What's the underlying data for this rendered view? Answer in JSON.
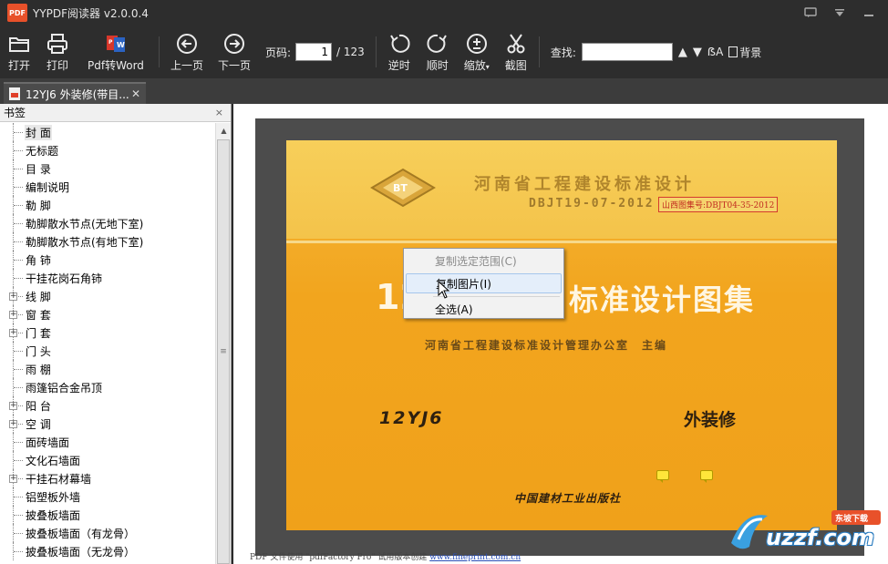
{
  "window": {
    "logo_text": "PDF",
    "title": "YYPDF阅读器 v2.0.0.4"
  },
  "toolbar": {
    "open": "打开",
    "print": "打印",
    "pdf_to_word": "Pdf转Word",
    "prev_page": "上一页",
    "next_page": "下一页",
    "page_label": "页码:",
    "page_current": "1",
    "page_total": "/ 123",
    "rotate_ccw": "逆时",
    "rotate_cw": "顺时",
    "zoom": "缩放",
    "screenshot": "截图",
    "find_label": "查找:",
    "find_value": "",
    "background": "背景"
  },
  "tab": {
    "label": "12YJ6 外装修(带目...",
    "close": "✕"
  },
  "sidebar": {
    "title": "书签",
    "close": "×",
    "items": [
      {
        "label": "封 面",
        "expandable": false,
        "selected": true
      },
      {
        "label": "无标题",
        "expandable": false
      },
      {
        "label": "目 录",
        "expandable": false
      },
      {
        "label": "编制说明",
        "expandable": false
      },
      {
        "label": "勒 脚",
        "expandable": false
      },
      {
        "label": "勒脚散水节点(无地下室)",
        "expandable": false
      },
      {
        "label": "勒脚散水节点(有地下室)",
        "expandable": false
      },
      {
        "label": "角 铈",
        "expandable": false
      },
      {
        "label": "干挂花岗石角铈",
        "expandable": false
      },
      {
        "label": "线 脚",
        "expandable": true
      },
      {
        "label": "窗 套",
        "expandable": true
      },
      {
        "label": "门 套",
        "expandable": true
      },
      {
        "label": "门 头",
        "expandable": false
      },
      {
        "label": "雨 棚",
        "expandable": false
      },
      {
        "label": "雨篷铝合金吊顶",
        "expandable": false
      },
      {
        "label": "阳 台",
        "expandable": true
      },
      {
        "label": "空 调",
        "expandable": true
      },
      {
        "label": "面砖墙面",
        "expandable": false
      },
      {
        "label": "文化石墙面",
        "expandable": false
      },
      {
        "label": "干挂石材幕墙",
        "expandable": true
      },
      {
        "label": "铝塑板外墙",
        "expandable": false
      },
      {
        "label": "披叠板墙面",
        "expandable": false
      },
      {
        "label": "披叠板墙面（有龙骨）",
        "expandable": false
      },
      {
        "label": "披叠板墙面（无龙骨）",
        "expandable": false
      }
    ]
  },
  "cover": {
    "logo": "BT",
    "org": "河南省工程建设标准设计",
    "code": "DBJT19-07-2012",
    "stamp": "山西图集号:DBJT04-35-2012",
    "big_left": "12",
    "big_right": "标准设计图集",
    "subtitle": "河南省工程建设标准设计管理办公室　主编",
    "number": "12YJ6",
    "title": "外装修",
    "publisher": "中国建材工业出版社"
  },
  "footer": {
    "text": "PDF 文件使用 \"pdfFactory Pro\" 试用版本创建 ",
    "link": "www.fineprint.com.cn"
  },
  "context_menu": {
    "items": [
      {
        "label": "复制选定范围(C)",
        "disabled": true
      },
      {
        "label": "复制图片(I)",
        "hover": true
      },
      {
        "label": "全选(A)"
      }
    ]
  },
  "watermark": {
    "text": "uzzf.com",
    "badge": "东坡下载"
  },
  "colors": {
    "chrome": "#2d2d2d",
    "cover_orange": "#f2a51e",
    "accent_red": "#e8512a"
  }
}
